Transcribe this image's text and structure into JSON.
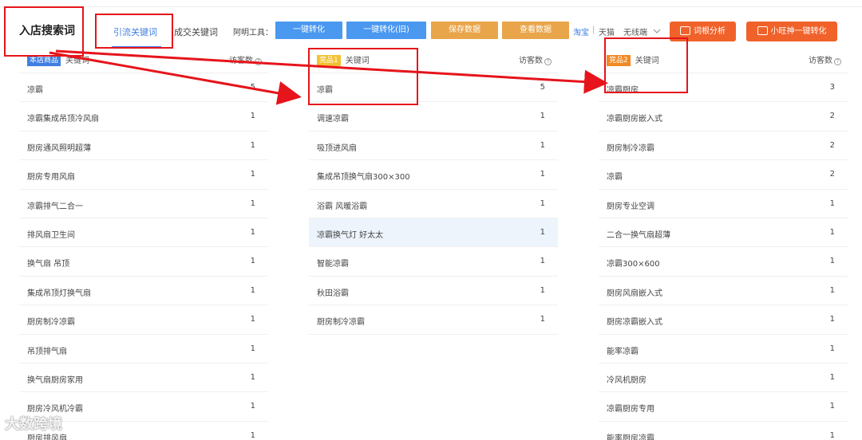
{
  "page": {
    "title": "入店搜索词"
  },
  "tabs": [
    {
      "label": "引流关键词",
      "active": true
    },
    {
      "label": "成交关键词",
      "active": false
    }
  ],
  "toolbar": {
    "label": "阿明工具：",
    "buttons": [
      {
        "label": "一键转化",
        "color": "#4a98f0"
      },
      {
        "label": "一键转化(旧)",
        "color": "#4a98f0"
      },
      {
        "label": "保存数据",
        "color": "#e9a54a"
      },
      {
        "label": "查看数据",
        "color": "#e9a54a"
      }
    ],
    "platform_taobao": "淘宝",
    "platform_sep": "|",
    "platform_tmall": "天猫",
    "device": "无线端",
    "device_chevron": "chevron-down-icon",
    "btn_word_root": "词根分析",
    "btn_xiaowang": "小旺神一键转化",
    "btn_icon": "camera-icon"
  },
  "columns": [
    {
      "badge": "本店商品",
      "badge_color": "#3f7fe0",
      "keyword_header": "关键词",
      "visits_header": "访客数",
      "rows": [
        {
          "kw": "凉霸",
          "n": "5"
        },
        {
          "kw": "凉霸集成吊顶冷风扇",
          "n": "1"
        },
        {
          "kw": "厨房通风照明超薄",
          "n": "1"
        },
        {
          "kw": "厨房专用风扇",
          "n": "1"
        },
        {
          "kw": "凉霸排气二合一",
          "n": "1"
        },
        {
          "kw": "排风扇卫生间",
          "n": "1"
        },
        {
          "kw": "换气扇 吊顶",
          "n": "1"
        },
        {
          "kw": "集成吊顶灯换气扇",
          "n": "1"
        },
        {
          "kw": "厨房制冷凉霸",
          "n": "1"
        },
        {
          "kw": "吊顶排气扇",
          "n": "1"
        },
        {
          "kw": "换气扇厨房家用",
          "n": "1"
        },
        {
          "kw": "厨房冷风机冷霸",
          "n": "1"
        },
        {
          "kw": "厨房排风扇",
          "n": "1"
        }
      ]
    },
    {
      "badge": "竞品1",
      "badge_color": "#f1c232",
      "keyword_header": "关键词",
      "visits_header": "访客数",
      "rows": [
        {
          "kw": "凉霸",
          "n": "5"
        },
        {
          "kw": "调速凉霸",
          "n": "1"
        },
        {
          "kw": "吸顶进风扇",
          "n": "1"
        },
        {
          "kw": "集成吊顶换气扇300×300",
          "n": "1"
        },
        {
          "kw": "浴霸 风暖浴霸",
          "n": "1"
        },
        {
          "kw": "凉霸换气灯 好太太",
          "n": "1",
          "highlight": true
        },
        {
          "kw": "智能凉霸",
          "n": "1"
        },
        {
          "kw": "秋田浴霸",
          "n": "1"
        },
        {
          "kw": "厨房制冷凉霸",
          "n": "1"
        }
      ]
    },
    {
      "badge": "竞品2",
      "badge_color": "#f08a24",
      "keyword_header": "关键词",
      "visits_header": "访客数",
      "rows": [
        {
          "kw": "凉霸厨房",
          "n": "3"
        },
        {
          "kw": "凉霸厨房嵌入式",
          "n": "2"
        },
        {
          "kw": "厨房制冷凉霸",
          "n": "2"
        },
        {
          "kw": "凉霸",
          "n": "2"
        },
        {
          "kw": "厨房专业空调",
          "n": "1"
        },
        {
          "kw": "二合一换气扇超薄",
          "n": "1"
        },
        {
          "kw": "凉霸300×600",
          "n": "1"
        },
        {
          "kw": "厨房风扇嵌入式",
          "n": "1"
        },
        {
          "kw": "厨房凉霸嵌入式",
          "n": "1"
        },
        {
          "kw": "能率凉霸",
          "n": "1"
        },
        {
          "kw": "冷风机厨房",
          "n": "1"
        },
        {
          "kw": "凉霸厨房专用",
          "n": "1"
        },
        {
          "kw": "能率厨房凉霸",
          "n": "1"
        }
      ]
    }
  ],
  "annotation_color": "#e6141b",
  "watermark": "大数跨境",
  "help_glyph": "?"
}
